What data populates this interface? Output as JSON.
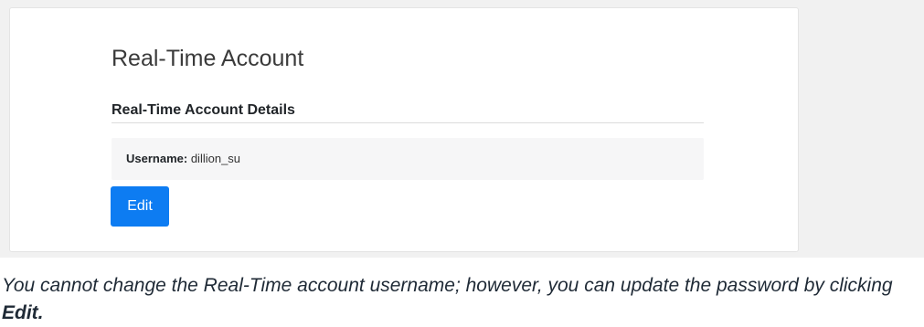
{
  "card": {
    "title": "Real-Time Account",
    "section_title": "Real-Time Account Details",
    "username_label": "Username:",
    "username_value": "dillion_su",
    "edit_label": "Edit"
  },
  "caption": {
    "text": "You cannot change the Real-Time account username; however, you can update the password by clicking ",
    "emphasis": "Edit."
  },
  "colors": {
    "primary_button": "#0d7cf2",
    "detail_background": "#f6f6f7",
    "page_background": "#f1f1f1"
  }
}
